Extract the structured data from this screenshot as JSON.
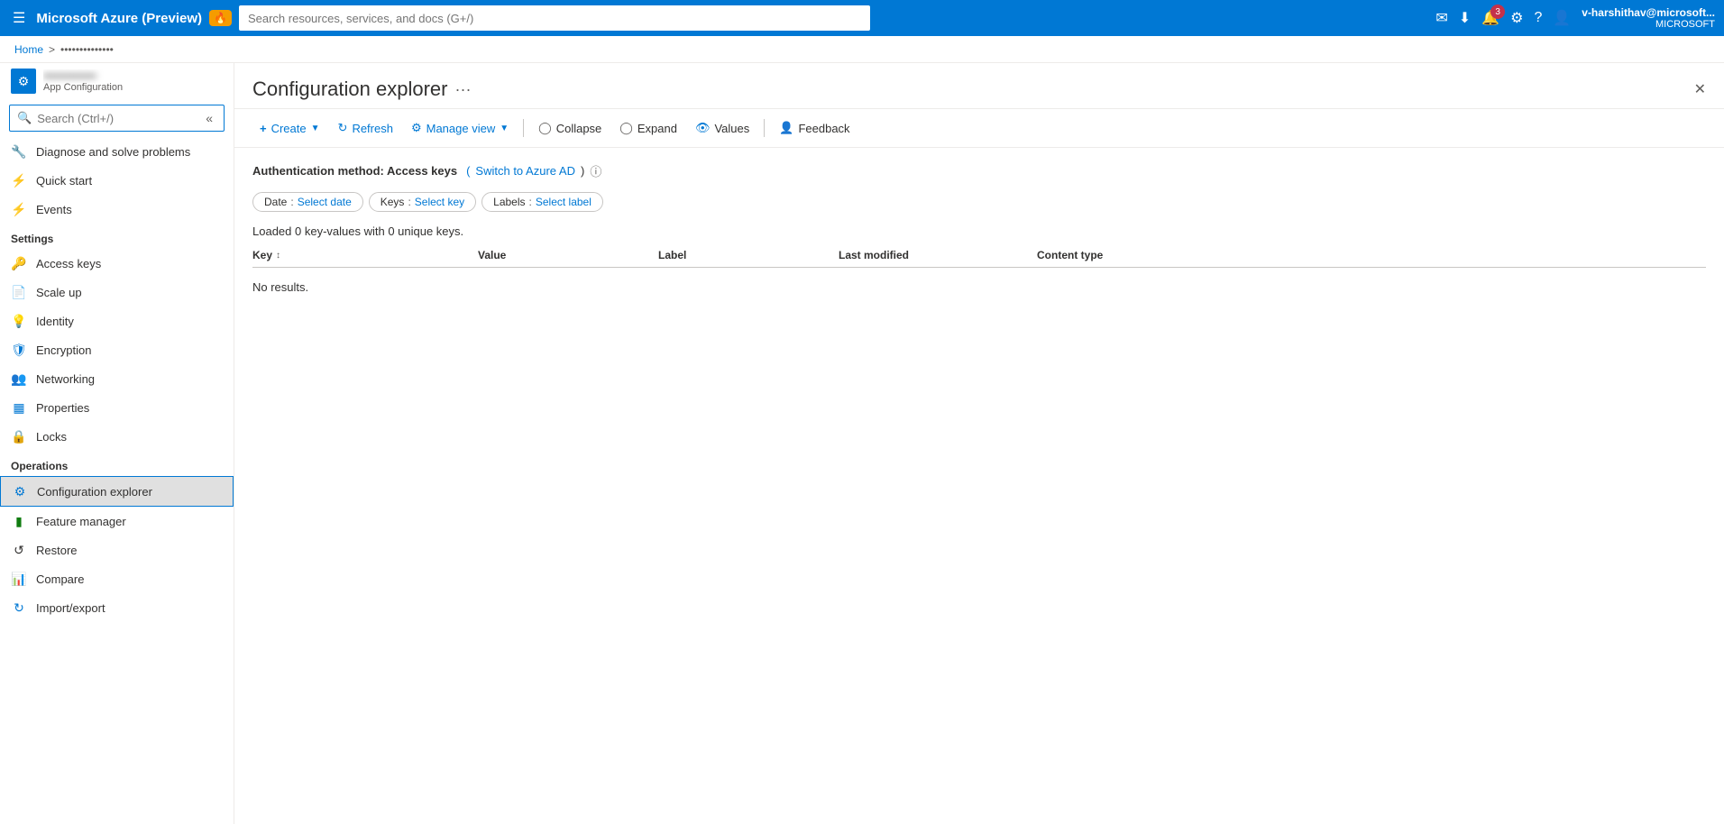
{
  "topbar": {
    "menu_icon": "≡",
    "title": "Microsoft Azure (Preview)",
    "badge": "🔥",
    "search_placeholder": "Search resources, services, and docs (G+/)",
    "icons": [
      "✉",
      "⬇",
      "🔔",
      "⚙",
      "?",
      "👤"
    ],
    "notification_count": "3",
    "user_name": "v-harshithav@microsoft...",
    "user_org": "MICROSOFT"
  },
  "breadcrumb": {
    "home": "Home",
    "separator": ">",
    "resource": "••••••••••••••"
  },
  "resource": {
    "icon": "⚙",
    "name": "••••••••••••••",
    "type": "App Configuration"
  },
  "sidebar": {
    "search_placeholder": "Search (Ctrl+/)",
    "items_top": [
      {
        "id": "diagnose",
        "label": "Diagnose and solve problems",
        "icon": "🔧"
      },
      {
        "id": "quickstart",
        "label": "Quick start",
        "icon": "⚡"
      },
      {
        "id": "events",
        "label": "Events",
        "icon": "⚡"
      }
    ],
    "sections": [
      {
        "label": "Settings",
        "items": [
          {
            "id": "access-keys",
            "label": "Access keys",
            "icon": "🔑"
          },
          {
            "id": "scale-up",
            "label": "Scale up",
            "icon": "📋"
          },
          {
            "id": "identity",
            "label": "Identity",
            "icon": "💡"
          },
          {
            "id": "encryption",
            "label": "Encryption",
            "icon": "🛡"
          },
          {
            "id": "networking",
            "label": "Networking",
            "icon": "👥"
          },
          {
            "id": "properties",
            "label": "Properties",
            "icon": "📊"
          },
          {
            "id": "locks",
            "label": "Locks",
            "icon": "🔒"
          }
        ]
      },
      {
        "label": "Operations",
        "items": [
          {
            "id": "config-explorer",
            "label": "Configuration explorer",
            "icon": "⚙",
            "active": true
          },
          {
            "id": "feature-manager",
            "label": "Feature manager",
            "icon": "🟩"
          },
          {
            "id": "restore",
            "label": "Restore",
            "icon": "↩"
          },
          {
            "id": "compare",
            "label": "Compare",
            "icon": "📊"
          },
          {
            "id": "import-export",
            "label": "Import/export",
            "icon": "🔄"
          }
        ]
      }
    ]
  },
  "content": {
    "title": "Configuration explorer",
    "more_icon": "···",
    "close_icon": "✕"
  },
  "toolbar": {
    "create_label": "Create",
    "refresh_label": "Refresh",
    "manage_view_label": "Manage view",
    "collapse_label": "Collapse",
    "expand_label": "Expand",
    "values_label": "Values",
    "feedback_label": "Feedback"
  },
  "main": {
    "auth_text": "Authentication method: Access keys",
    "auth_link": "Switch to Azure AD",
    "loaded_text": "Loaded 0 key-values with 0 unique keys.",
    "filters": [
      {
        "label": "Date",
        "separator": " : ",
        "value": "Select date"
      },
      {
        "label": "Keys",
        "separator": " : ",
        "value": "Select key"
      },
      {
        "label": "Labels",
        "separator": " : ",
        "value": "Select label"
      }
    ],
    "columns": [
      {
        "label": "Key",
        "sortable": true
      },
      {
        "label": "Value",
        "sortable": false
      },
      {
        "label": "Label",
        "sortable": false
      },
      {
        "label": "Last modified",
        "sortable": false
      },
      {
        "label": "Content type",
        "sortable": false
      }
    ],
    "no_results": "No results."
  }
}
